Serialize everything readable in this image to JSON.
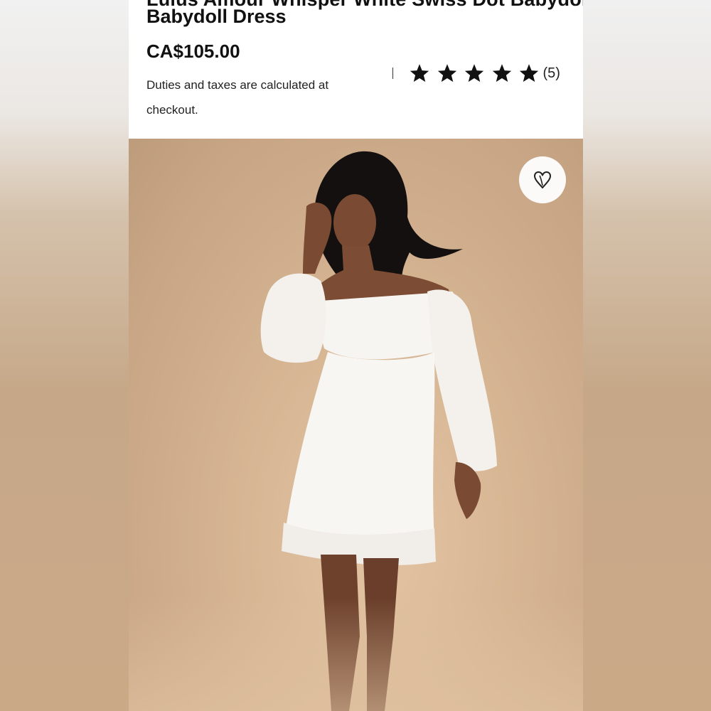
{
  "product": {
    "title_cut": "Lulus Amour Whisper White Swiss Dot Babydoll",
    "title": "Babydoll Dress",
    "price": "CA$105.00",
    "duties_note": "Duties and taxes are calculated at checkout.",
    "rating": {
      "stars": 5,
      "max": 5,
      "count_text": "(5)"
    }
  },
  "photo": {
    "alt": "Model wearing white off-the-shoulder babydoll dress",
    "favorite_icon": "heart-icon"
  },
  "colors": {
    "background": "#ffffff",
    "text": "#111111",
    "photo_bg": "#d6b593",
    "dress": "#f7f5f2",
    "star": "#111111"
  }
}
